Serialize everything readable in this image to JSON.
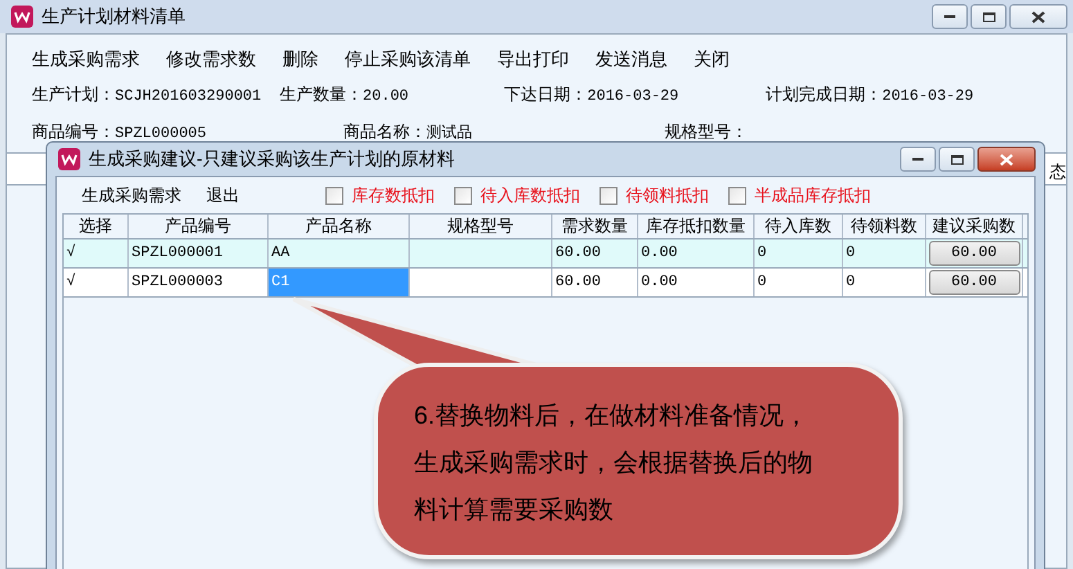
{
  "window": {
    "title": "生产计划材料清单"
  },
  "menu": [
    "生成采购需求",
    "修改需求数",
    "删除",
    "停止采购该清单",
    "导出打印",
    "发送消息",
    "关闭"
  ],
  "info": [
    {
      "label": "生产计划：",
      "value": "SCJH201603290001"
    },
    {
      "label": "生产数量：",
      "value": "20.00"
    },
    {
      "label": "下达日期：",
      "value": "2016-03-29"
    },
    {
      "label": "计划完成日期：",
      "value": "2016-03-29"
    }
  ],
  "info2": [
    {
      "label": "商品编号：",
      "value": "SPZL000005"
    },
    {
      "label": "商品名称：",
      "value": "测试品"
    },
    {
      "label": "规格型号："
    }
  ],
  "table": {
    "column_1": "态"
  },
  "dialog": {
    "title": "生成采购建议-只建议采购该生产计划的原材料",
    "actions": [
      "生成采购需求",
      "退出"
    ],
    "options": [
      {
        "label": "库存数抵扣",
        "checked": false
      },
      {
        "label": "待入库数抵扣",
        "checked": false
      },
      {
        "label": "待领料抵扣",
        "checked": false
      },
      {
        "label": "半成品库存抵扣",
        "checked": false
      }
    ],
    "columns": [
      "选择",
      "产品编号",
      "产品名称",
      "规格型号",
      "需求数量",
      "库存抵扣数量",
      "待入库数",
      "待领料数",
      "建议采购数"
    ],
    "rows": [
      {
        "check": "√",
        "code": "SPZL000001",
        "name": "AA",
        "spec": "",
        "demand": "60.00",
        "deduct": "0.00",
        "incoming": "0",
        "pending": "0",
        "suggest": "60.00",
        "selected": false
      },
      {
        "check": "√",
        "code": "SPZL000003",
        "name": "C1",
        "spec": "",
        "demand": "60.00",
        "deduct": "0.00",
        "incoming": "0",
        "pending": "0",
        "suggest": "60.00",
        "selected": true
      }
    ]
  },
  "callout": {
    "text": "6.替换物料后，在做材料准备情况，生成采购需求时，会根据替换后的物料计算需要采购数"
  }
}
